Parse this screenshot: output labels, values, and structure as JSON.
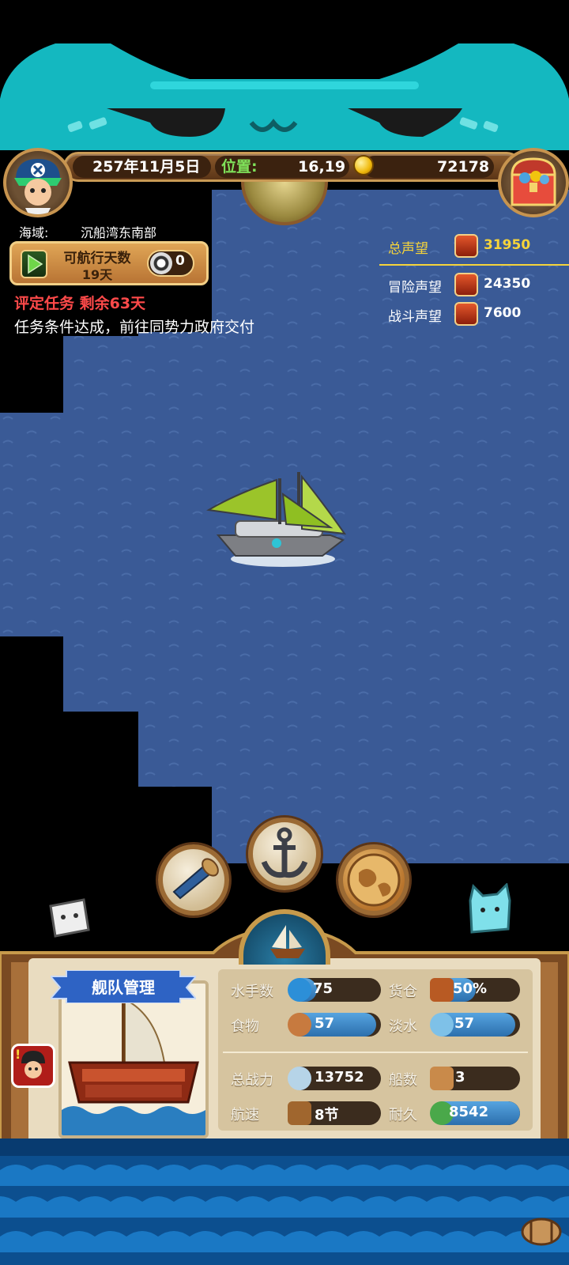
{
  "top_bar": {
    "date": "257年11月5日",
    "position_label": "位置:",
    "position_value": "16,19",
    "gold": "72178"
  },
  "sea_region": {
    "label": "海域:",
    "value": "沉船湾东南部"
  },
  "sailing": {
    "label": "可航行天数",
    "days": "19天",
    "counter": "0"
  },
  "quest": {
    "rating": "评定任务 剩余63天",
    "status": "任务条件达成，前往同势力政府交付"
  },
  "reputation": {
    "total_label": "总声望",
    "total_value": "31950",
    "adventure_label": "冒险声望",
    "adventure_value": "24350",
    "battle_label": "战斗声望",
    "battle_value": "7600"
  },
  "fleet": {
    "title": "舰队管理",
    "sailors_label": "水手数",
    "sailors_value": "75",
    "cargo_label": "货仓",
    "cargo_value": "50%",
    "food_label": "食物",
    "food_value": "57",
    "water_label": "淡水",
    "water_value": "57",
    "power_label": "总战力",
    "power_value": "13752",
    "ships_label": "船数",
    "ships_value": "3",
    "speed_label": "航速",
    "speed_value": "8节",
    "durability_label": "耐久",
    "durability_value": "8542"
  },
  "colors": {
    "ocean": "#3a5a96",
    "gold_text": "#f6d43a",
    "position_green": "#7fe25a",
    "alert_red": "#ff4a4a",
    "bar_blue": "#3b86c8"
  },
  "icons": [
    "gold-coin-icon",
    "treasure-chest-icon",
    "play-icon",
    "compass-icon",
    "reputation-icon",
    "spyglass-icon",
    "anchor-icon",
    "world-map-icon",
    "ship-icon"
  ]
}
